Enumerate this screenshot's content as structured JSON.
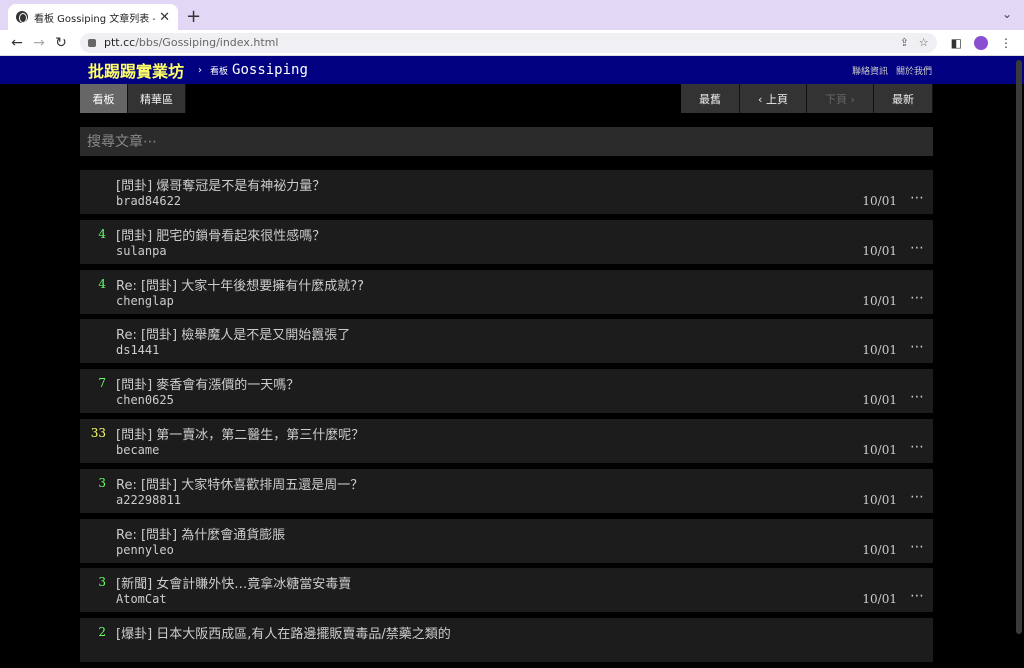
{
  "browser": {
    "tab_title": "看板 Gossiping 文章列表 - 批踢踢",
    "url_host": "ptt.cc",
    "url_path": "/bbs/Gossiping/index.html"
  },
  "site": {
    "brand": "批踢踢實業坊",
    "crumb_sep": "›",
    "crumb_label": "看板",
    "board": "Gossiping",
    "links": [
      "聯絡資訊",
      "關於我們"
    ]
  },
  "buttons": {
    "board": "看板",
    "digest": "精華區",
    "oldest": "最舊",
    "prev": "‹ 上頁",
    "next": "下頁 ›",
    "newest": "最新"
  },
  "search": {
    "placeholder": "搜尋文章⋯"
  },
  "posts": [
    {
      "nrec": "",
      "title": "[問卦] 爆哥奪冠是不是有神祕力量？",
      "author": "brad84622",
      "date": "10/01"
    },
    {
      "nrec": "4",
      "title": "[問卦] 肥宅的鎖骨看起來很性感嗎？",
      "author": "sulanpa",
      "date": "10/01"
    },
    {
      "nrec": "4",
      "title": "Re: [問卦] 大家十年後想要擁有什麼成就??",
      "author": "chenglap",
      "date": "10/01"
    },
    {
      "nrec": "",
      "title": "Re: [問卦] 檢舉魔人是不是又開始囂張了",
      "author": "ds1441",
      "date": "10/01"
    },
    {
      "nrec": "7",
      "title": "[問卦] 麥香會有漲價的一天嗎？",
      "author": "chen0625",
      "date": "10/01"
    },
    {
      "nrec": "33",
      "title": "[問卦] 第一賣冰，第二醫生，第三什麼呢？",
      "author": "became",
      "date": "10/01"
    },
    {
      "nrec": "3",
      "title": "Re: [問卦] 大家特休喜歡排周五還是周一？",
      "author": "a22298811",
      "date": "10/01"
    },
    {
      "nrec": "",
      "title": "Re: [問卦] 為什麼會通貨膨脹",
      "author": "pennyleo",
      "date": "10/01"
    },
    {
      "nrec": "3",
      "title": "[新聞] 女會計賺外快…竟拿冰糖當安毒賣",
      "author": "AtomCat",
      "date": "10/01"
    },
    {
      "nrec": "2",
      "title": "[爆卦] 日本大阪西成區,有人在路邊擺販賣毒品/禁藥之類的",
      "author": "",
      "date": ""
    }
  ],
  "more_glyph": "⋯"
}
